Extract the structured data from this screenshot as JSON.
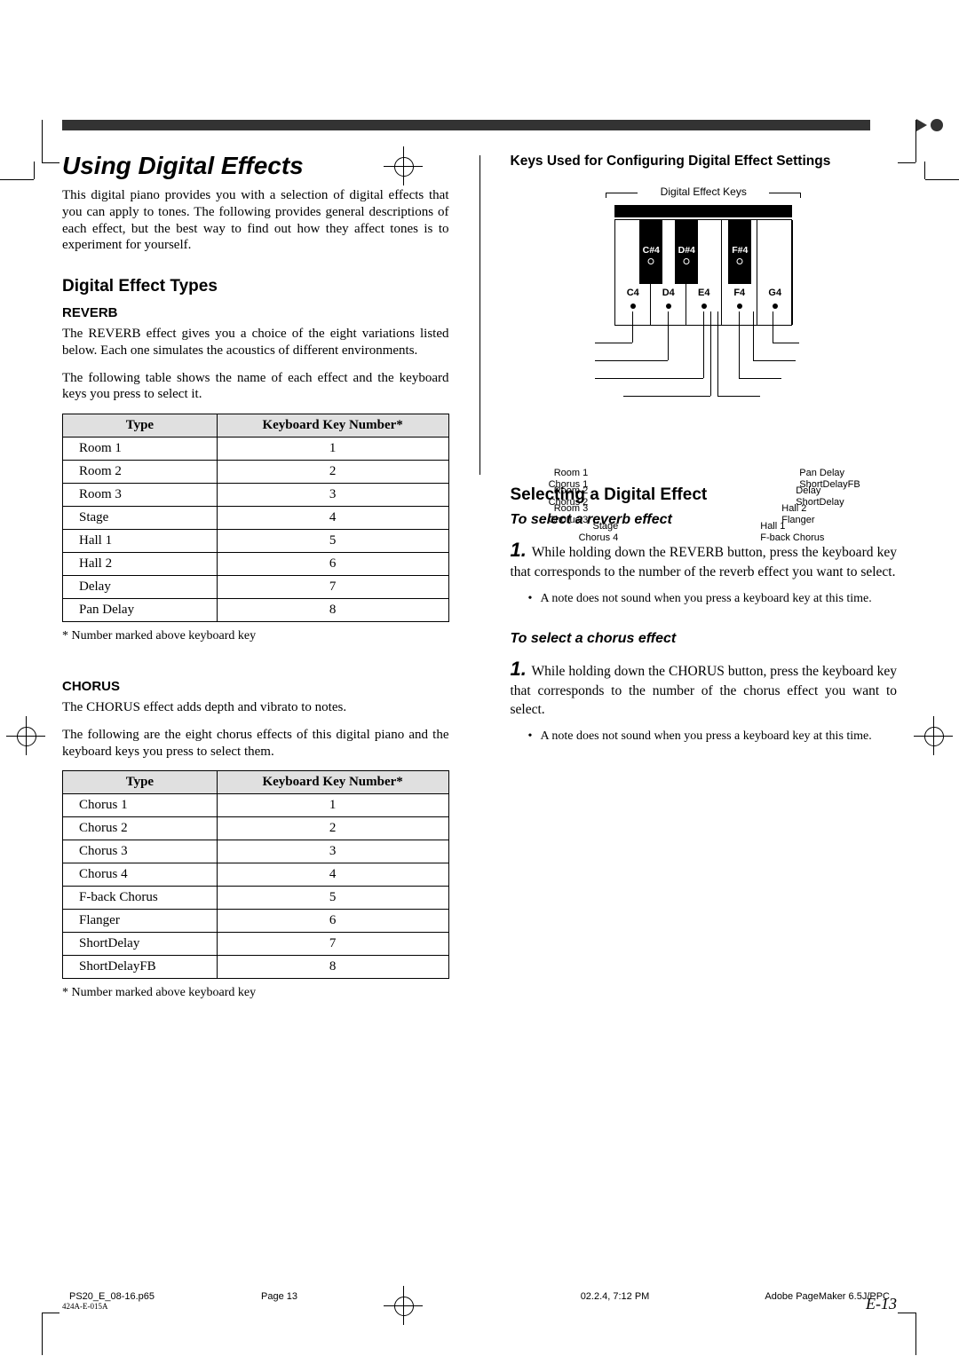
{
  "header_title": "Using Digital Effects",
  "intro_text": "This digital piano provides you with a selection of digital effects that you can apply to tones. The following provides general descriptions of each effect, but the best way to find out how they affect tones is to experiment for yourself.",
  "digital_effect_types_heading": "Digital Effect Types",
  "reverb": {
    "heading": "REVERB",
    "desc": "The REVERB effect gives you a choice of the eight variations listed below. Each one simulates the acoustics of different environments.",
    "table_intro": "The following table shows the name of each effect and the keyboard keys you press to select it.",
    "headers": {
      "type": "Type",
      "keynum": "Keyboard Key Number*"
    },
    "rows": [
      {
        "type": "Room 1",
        "num": "1"
      },
      {
        "type": "Room 2",
        "num": "2"
      },
      {
        "type": "Room 3",
        "num": "3"
      },
      {
        "type": "Stage",
        "num": "4"
      },
      {
        "type": "Hall 1",
        "num": "5"
      },
      {
        "type": "Hall 2",
        "num": "6"
      },
      {
        "type": "Delay",
        "num": "7"
      },
      {
        "type": "Pan Delay",
        "num": "8"
      }
    ],
    "footnote": "* Number marked above keyboard key"
  },
  "chorus": {
    "heading": "CHORUS",
    "desc": "The CHORUS effect adds depth and vibrato to notes.",
    "table_intro": "The following are the eight chorus effects of this digital piano and the keyboard keys you press to select them.",
    "headers": {
      "type": "Type",
      "keynum": "Keyboard Key Number*"
    },
    "rows": [
      {
        "type": "Chorus 1",
        "num": "1"
      },
      {
        "type": "Chorus 2",
        "num": "2"
      },
      {
        "type": "Chorus 3",
        "num": "3"
      },
      {
        "type": "Chorus 4",
        "num": "4"
      },
      {
        "type": "F-back Chorus",
        "num": "5"
      },
      {
        "type": "Flanger",
        "num": "6"
      },
      {
        "type": "ShortDelay",
        "num": "7"
      },
      {
        "type": "ShortDelayFB",
        "num": "8"
      }
    ],
    "footnote": "* Number marked above keyboard key"
  },
  "right_col": {
    "keys_config_heading": "Keys Used for Configuring Digital Effect Settings",
    "kbd_bracket_label": "Digital Effect Keys",
    "white_keys": [
      "C4",
      "D4",
      "E4",
      "F4",
      "G4"
    ],
    "black_keys": [
      "C#4",
      "D#4",
      "F#4"
    ],
    "left_map": [
      {
        "line1": "Room 1",
        "line2": "Chorus 1"
      },
      {
        "line1": "Room 2",
        "line2": "Chorus 2"
      },
      {
        "line1": "Room 3",
        "line2": "Chorus 3"
      },
      {
        "line1": "Stage",
        "line2": "Chorus 4"
      }
    ],
    "right_map": [
      {
        "line1": "Pan Delay",
        "line2": "ShortDelayFB"
      },
      {
        "line1": "Delay",
        "line2": "ShortDelay"
      },
      {
        "line1": "Hall 2",
        "line2": "Flanger"
      },
      {
        "line1": "Hall 1",
        "line2": "F-back Chorus"
      }
    ],
    "selecting_heading": "Selecting a Digital Effect",
    "select_reverb_heading": "To select a reverb effect",
    "step_reverb": "While holding down the REVERB button, press the keyboard key that corresponds to the number of the reverb effect you want to select.",
    "note_text": "A note does not sound when you press a keyboard key at this time.",
    "select_chorus_heading": "To select a chorus effect",
    "step_chorus": "While holding down the CHORUS button, press the keyboard key that corresponds to the number of the chorus effect you want to select."
  },
  "doc_id": "424A-E-015A",
  "page_label": "E-13",
  "print_footer": {
    "file": "PS20_E_08-16.p65",
    "page": "Page 13",
    "datetime": "02.2.4, 7:12 PM",
    "app": "Adobe PageMaker 6.5J/PPC"
  }
}
